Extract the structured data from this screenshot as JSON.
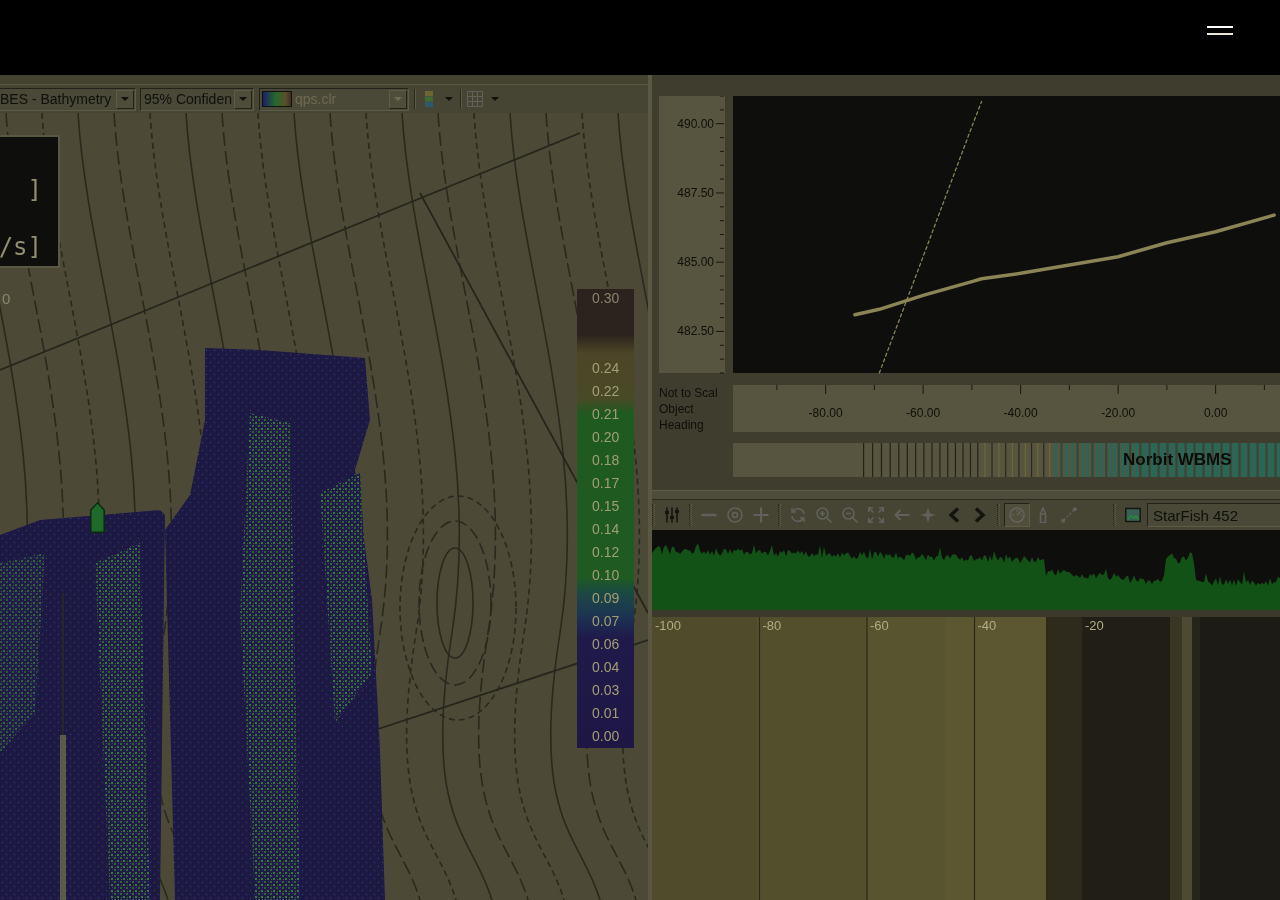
{
  "map_pane": {
    "toolbar": {
      "layer_dropdown": {
        "value": "BES - Bathymetry",
        "disabled": false
      },
      "confidence_dropdown": {
        "value": "95% Confiden",
        "disabled": false
      },
      "color_file_dropdown": {
        "value": "qps.clr",
        "disabled": true
      },
      "tools": [
        {
          "kind": "layers",
          "disabled": false
        },
        {
          "kind": "grid",
          "disabled": true
        }
      ]
    },
    "readout": {
      "lines": [
        "]",
        "/s]"
      ],
      "value": "0"
    },
    "color_scale": {
      "max_label": "0.30",
      "labels": [
        "0.24",
        "0.22",
        "0.21",
        "0.20",
        "0.18",
        "0.17",
        "0.15",
        "0.14",
        "0.12",
        "0.10",
        "0.09",
        "0.07",
        "0.06",
        "0.04",
        "0.03",
        "0.01",
        "0.00"
      ]
    }
  },
  "profile_panel": {
    "chart_data": {
      "type": "line",
      "x": [
        -74,
        -69,
        -60,
        -50,
        -48,
        -40,
        -30,
        -20,
        -10,
        0,
        12
      ],
      "series": [
        {
          "color": "#8a8456",
          "line_style": "solid",
          "values": [
            483.1,
            483.3,
            483.8,
            484.3,
            484.4,
            484.6,
            484.9,
            485.2,
            485.7,
            486.1,
            486.7
          ]
        },
        {
          "color": "#8a8456",
          "line_style": "dashed",
          "values": [
            null,
            481.0,
            485.2,
            489.9,
            490.8,
            null,
            null,
            null,
            null,
            null,
            null
          ]
        }
      ],
      "xlim": [
        -99,
        13.2
      ],
      "ylim": [
        481,
        491
      ],
      "xticks": [
        {
          "value": -80,
          "label": "-80.00"
        },
        {
          "value": -60,
          "label": "-60.00"
        },
        {
          "value": -40,
          "label": "-40.00"
        },
        {
          "value": -20,
          "label": "-20.00"
        },
        {
          "value": 0,
          "label": "0.00"
        }
      ],
      "yticks": [
        {
          "value": 482.5,
          "label": "482.50"
        },
        {
          "value": 485,
          "label": "485.00"
        },
        {
          "value": 487.5,
          "label": "487.50"
        },
        {
          "value": 490,
          "label": "490.00"
        }
      ]
    },
    "side_labels": [
      "Not to Scal",
      "Object",
      "Heading"
    ],
    "heading_strip": {
      "label": "Norbit WBMS"
    }
  },
  "sonar_panel": {
    "tool_groups": [
      [
        {
          "kind": "sliders",
          "disabled": false,
          "pressed": false
        }
      ],
      [
        {
          "kind": "minus",
          "disabled": true,
          "pressed": false
        },
        {
          "kind": "target",
          "disabled": true,
          "pressed": false
        },
        {
          "kind": "plus",
          "disabled": true,
          "pressed": false
        }
      ],
      [
        {
          "kind": "refresh",
          "disabled": true,
          "pressed": false
        },
        {
          "kind": "zoom_in",
          "disabled": true,
          "pressed": false
        },
        {
          "kind": "zoom_out",
          "disabled": true,
          "pressed": false
        },
        {
          "kind": "expand",
          "disabled": true,
          "pressed": false
        },
        {
          "kind": "arrow_left",
          "disabled": true,
          "pressed": false
        },
        {
          "kind": "sparkle",
          "disabled": true,
          "pressed": false
        },
        {
          "kind": "chevron_left",
          "disabled": false,
          "pressed": false
        },
        {
          "kind": "chevron_right",
          "disabled": false,
          "pressed": false
        }
      ],
      [
        {
          "kind": "gauge",
          "disabled": true,
          "pressed": true
        },
        {
          "kind": "pen",
          "disabled": true,
          "pressed": false
        },
        {
          "kind": "measure",
          "disabled": true,
          "pressed": false
        }
      ],
      [
        {
          "kind": "image",
          "disabled": false,
          "pressed": false
        }
      ]
    ],
    "sensor_dropdown": {
      "value": "StarFish 452"
    },
    "range_labels": [
      "-100",
      "-80",
      "-60",
      "-40",
      "-20"
    ]
  }
}
